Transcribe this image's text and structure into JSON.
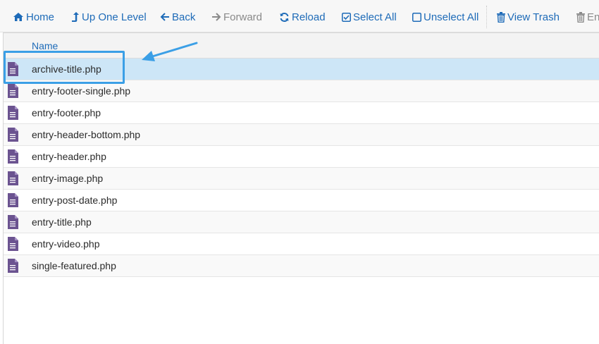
{
  "toolbar": {
    "home": "Home",
    "up_one_level": "Up One Level",
    "back": "Back",
    "forward": "Forward",
    "reload": "Reload",
    "select_all": "Select All",
    "unselect_all": "Unselect All",
    "view_trash": "View Trash",
    "empty_trash_partial": "En"
  },
  "file_list": {
    "column_name": "Name",
    "files": [
      "archive-title.php",
      "entry-footer-single.php",
      "entry-footer.php",
      "entry-header-bottom.php",
      "entry-header.php",
      "entry-image.php",
      "entry-post-date.php",
      "entry-title.php",
      "entry-video.php",
      "single-featured.php"
    ],
    "selected_index": 0
  },
  "icons": {
    "file": "file-text-icon",
    "home": "home-icon",
    "up": "level-up-icon",
    "back": "arrow-left-icon",
    "forward": "arrow-right-icon",
    "reload": "reload-icon",
    "select_all": "checkbox-checked-icon",
    "unselect_all": "checkbox-empty-icon",
    "trash": "trash-icon"
  },
  "colors": {
    "link": "#1e6bb8",
    "disabled": "#8a8a8a",
    "selected_row": "#cde6f7",
    "file_icon": "#6b5390",
    "annotation": "#3b9fe6"
  }
}
